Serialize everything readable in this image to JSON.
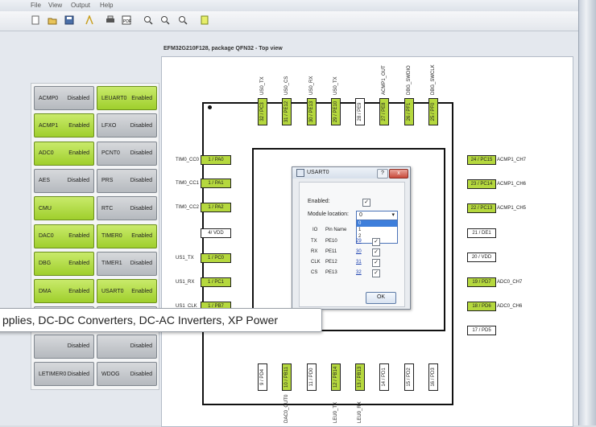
{
  "menu": [
    "File",
    "View",
    "Output",
    "Help"
  ],
  "toolbar_icons": [
    "new-icon",
    "open-icon",
    "save-icon",
    "chart-icon",
    "print-icon",
    "pdf-icon",
    "zoom-icon",
    "zoom-in-icon",
    "zoom-out-icon",
    "export-icon"
  ],
  "toolbar_pdf_label": "PDF",
  "doc_title": "EFM32G210F128, package QFN32 - Top view",
  "modules": [
    {
      "name": "ACMP0",
      "status": "Disabled",
      "on": false
    },
    {
      "name": "LEUART0",
      "status": "Enabled",
      "on": true
    },
    {
      "name": "ACMP1",
      "status": "Enabled",
      "on": true
    },
    {
      "name": "LFXO",
      "status": "Disabled",
      "on": false
    },
    {
      "name": "ADC0",
      "status": "Enabled",
      "on": true
    },
    {
      "name": "PCNT0",
      "status": "Disabled",
      "on": false
    },
    {
      "name": "AES",
      "status": "Disabled",
      "on": false
    },
    {
      "name": "PRS",
      "status": "Disabled",
      "on": false
    },
    {
      "name": "CMU",
      "status": "",
      "on": true
    },
    {
      "name": "RTC",
      "status": "Disabled",
      "on": false
    },
    {
      "name": "DAC0",
      "status": "Enabled",
      "on": true
    },
    {
      "name": "TIMER0",
      "status": "Enabled",
      "on": true
    },
    {
      "name": "DBG",
      "status": "Enabled",
      "on": true
    },
    {
      "name": "TIMER1",
      "status": "Disabled",
      "on": false
    },
    {
      "name": "DMA",
      "status": "Enabled",
      "on": true
    },
    {
      "name": "USART0",
      "status": "Enabled",
      "on": true
    },
    {
      "name": "",
      "status": "",
      "on": false
    },
    {
      "name": "",
      "status": "",
      "on": false
    },
    {
      "name": "",
      "status": "Disabled",
      "on": false
    },
    {
      "name": "",
      "status": "Disabled",
      "on": false
    },
    {
      "name": "LETIMER0",
      "status": "Disabled",
      "on": false
    },
    {
      "name": "WDOG",
      "status": "Disabled",
      "on": false
    }
  ],
  "pins_left": [
    {
      "label": "1 / PA0",
      "on": true,
      "func": "TIM0_CC0"
    },
    {
      "label": "1 / PA1",
      "on": true,
      "func": "TIM0_CC1"
    },
    {
      "label": "1 / PA2",
      "on": true,
      "func": "TIM0_CC2"
    },
    {
      "label": "4/ VDD",
      "on": false,
      "func": ""
    },
    {
      "label": "1 / PC0",
      "on": true,
      "func": "US1_TX"
    },
    {
      "label": "1 / PC1",
      "on": true,
      "func": "US1_RX"
    },
    {
      "label": "1 / PB7",
      "on": true,
      "func": "US1_CLK"
    }
  ],
  "pins_right": [
    {
      "label": "24 / PC15",
      "on": true,
      "func": "ACMP1_CH7"
    },
    {
      "label": "23 / PC14",
      "on": true,
      "func": "ACMP1_CH6"
    },
    {
      "label": "22 / PC13",
      "on": true,
      "func": "ACMP1_CH5"
    },
    {
      "label": "21 / DE1",
      "on": false,
      "func": ""
    },
    {
      "label": "20 / VDD",
      "on": false,
      "func": ""
    },
    {
      "label": "19 / PD7",
      "on": true,
      "func": "ADC0_CH7"
    },
    {
      "label": "18 / PD6",
      "on": true,
      "func": "ADC0_CH6"
    },
    {
      "label": "17 / PD5",
      "on": false,
      "func": ""
    }
  ],
  "pins_top": [
    {
      "label": "32 / PC3",
      "on": true,
      "func": "US0_TX"
    },
    {
      "label": "31 / PE12",
      "on": true,
      "func": "US0_CS"
    },
    {
      "label": "30 / PE13",
      "on": true,
      "func": "US0_RX"
    },
    {
      "label": "29 / PE10",
      "on": true,
      "func": "US0_TX"
    },
    {
      "label": "28 / PE9",
      "on": false,
      "func": ""
    },
    {
      "label": "27 / PE8",
      "on": true,
      "func": "ACMP1_OUT"
    },
    {
      "label": "26 / PF1",
      "on": true,
      "func": "DBG_SWDIO"
    },
    {
      "label": "25 / PF0",
      "on": true,
      "func": "DBG_SWCLK"
    }
  ],
  "pins_bottom": [
    {
      "label": "9 / PD4",
      "on": false,
      "func": ""
    },
    {
      "label": "10 / PB11",
      "on": true,
      "func": "DAC0_OUT0"
    },
    {
      "label": "11 / PD0",
      "on": false,
      "func": ""
    },
    {
      "label": "12 / PB14",
      "on": true,
      "func": "LEU0_TX"
    },
    {
      "label": "13 / PB13",
      "on": true,
      "func": "LEU0_RX"
    },
    {
      "label": "14 / PD1",
      "on": false,
      "func": ""
    },
    {
      "label": "15 / PD2",
      "on": false,
      "func": ""
    },
    {
      "label": "16 / PD3",
      "on": false,
      "func": ""
    }
  ],
  "dialog": {
    "title": "USART0",
    "help": "?",
    "close": "x",
    "enabled_label": "Enabled:",
    "location_label": "Module location:",
    "location_value": "0",
    "location_options": [
      "0",
      "1",
      "2"
    ],
    "io_header": "IO",
    "pin_header": "Pin Name",
    "rows": [
      {
        "io": "TX",
        "pin": "PE10",
        "num": "29"
      },
      {
        "io": "RX",
        "pin": "PE11",
        "num": "30"
      },
      {
        "io": "CLK",
        "pin": "PE12",
        "num": "31"
      },
      {
        "io": "CS",
        "pin": "PE13",
        "num": "32"
      }
    ],
    "ok": "OK"
  },
  "tooltip": "pplies, DC-DC Converters, DC-AC Inverters, XP Power"
}
